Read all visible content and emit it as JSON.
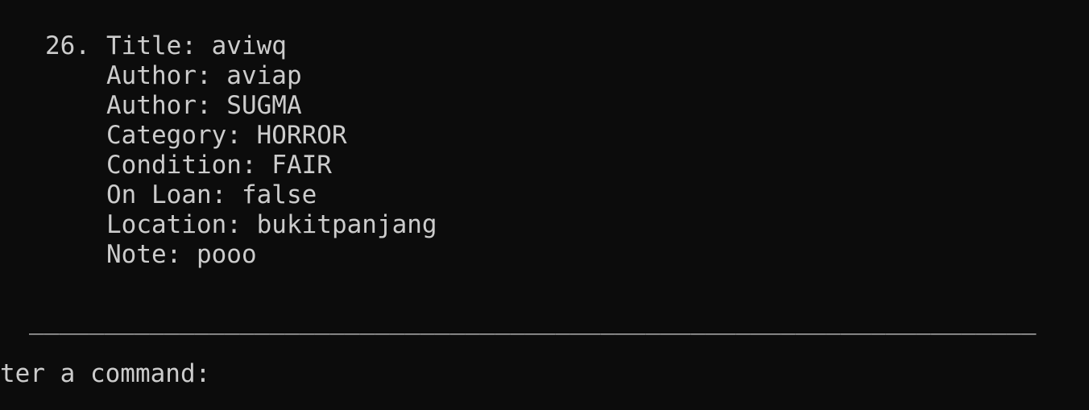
{
  "terminal": {
    "entry": {
      "index": "26.",
      "lines": [
        "Title: aviwq",
        "Author: aviap",
        "Author: SUGMA",
        "Category: HORROR",
        "Condition: FAIR",
        "On Loan: false",
        "Location: bukitpanjang",
        "Note: pooo"
      ]
    },
    "separator": "___________________________________________________________________",
    "prompt": "ter a command:"
  }
}
